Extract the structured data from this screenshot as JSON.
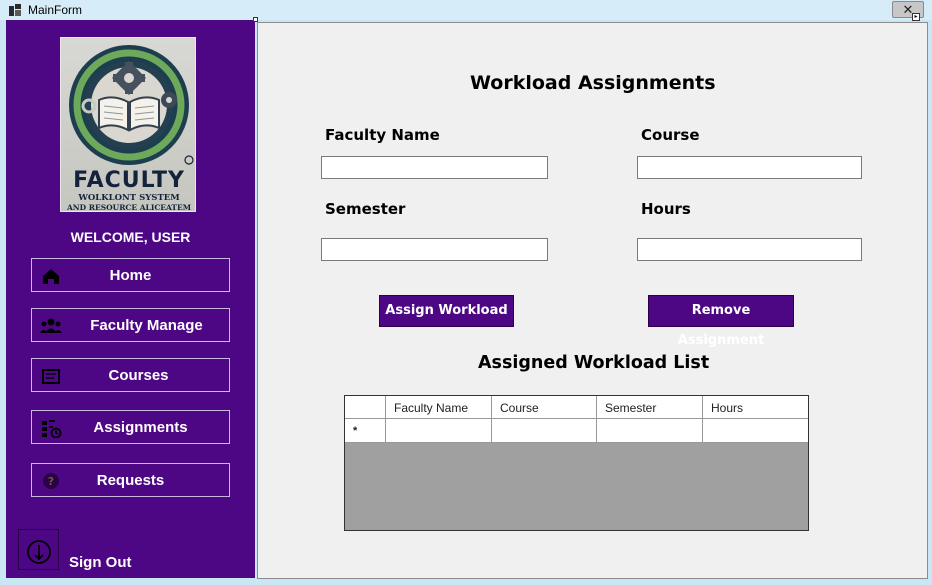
{
  "window": {
    "title": "MainForm",
    "close_glyph": "✕"
  },
  "sidebar": {
    "logo": {
      "line1": "FACULTY",
      "line2": "WOLKLONT SYSTEM",
      "line3": "AND RESOURCE ALICEATEM"
    },
    "welcome": "WELCOME, USER",
    "items": [
      {
        "label": "Home",
        "icon": "home-icon"
      },
      {
        "label": "Faculty Manage",
        "icon": "people-icon"
      },
      {
        "label": "Courses",
        "icon": "book-icon"
      },
      {
        "label": "Assignments",
        "icon": "assignment-icon"
      },
      {
        "label": "Requests",
        "icon": "question-icon"
      }
    ],
    "signout": {
      "label": "Sign Out",
      "icon": "power-icon"
    }
  },
  "main": {
    "title": "Workload Assignments",
    "fields": [
      {
        "label": "Faculty Name",
        "value": "",
        "placeholder": ""
      },
      {
        "label": "Course",
        "value": "",
        "placeholder": ""
      },
      {
        "label": "Semester",
        "value": "",
        "placeholder": ""
      },
      {
        "label": "Hours",
        "value": "",
        "placeholder": ""
      }
    ],
    "buttons": {
      "assign": "Assign Workload",
      "remove": "Remove Assignment"
    },
    "list_title": "Assigned Workload List",
    "grid": {
      "columns": [
        "Faculty Name",
        "Course",
        "Semester",
        "Hours"
      ],
      "new_row_marker": "*"
    }
  },
  "colors": {
    "sidebar": "#4d0784",
    "panel": "#f0f0f0",
    "grid_empty": "#a0a0a0"
  }
}
